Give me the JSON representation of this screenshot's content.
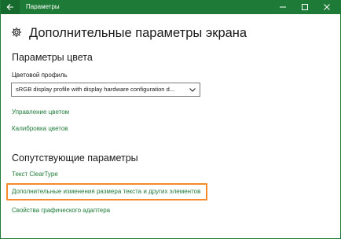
{
  "window": {
    "title": "Параметры",
    "accent": "#1e7b37",
    "link_color": "#1f7a38",
    "highlight_color": "#f48a2a"
  },
  "titlebar": {
    "back_icon": "arrow-left-icon",
    "controls": [
      "minimize-icon",
      "maximize-icon",
      "close-icon"
    ]
  },
  "header": {
    "icon": "gear-icon",
    "title": "Дополнительные параметры экрана"
  },
  "color_settings": {
    "section_title": "Параметры цвета",
    "profile_label": "Цветовой профиль",
    "profile_value": "sRGB display profile with display hardware configuration d...",
    "links": {
      "color_management": "Управление цветом",
      "color_calibration": "Калибровка цветов"
    }
  },
  "related_settings": {
    "section_title": "Сопутствующие параметры",
    "links": {
      "cleartype": "Текст ClearType",
      "text_size": "Дополнительные изменения размера текста и других элементов",
      "adapter": "Свойства графического адаптера"
    },
    "highlighted": "text_size"
  }
}
